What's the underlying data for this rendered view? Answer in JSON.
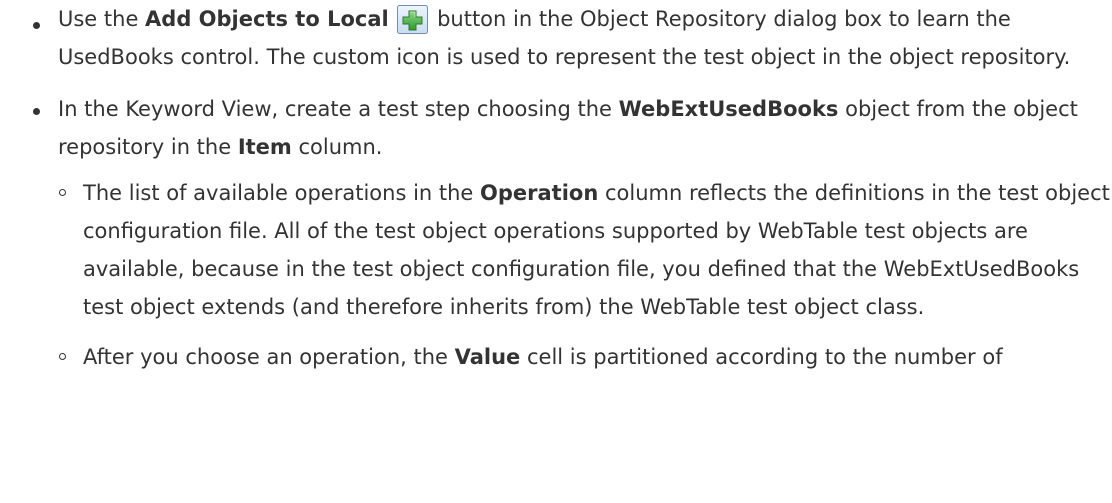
{
  "bullets": [
    {
      "before": "Use the ",
      "bold": "Add Objects to Local",
      "icon": "add-objects-plus-icon",
      "after": " button in the Object Repository dialog box to learn the UsedBooks control. The custom icon is used to represent the test object in the object repository."
    },
    {
      "part1": "In the Keyword View, create a test step choosing the ",
      "bold1": "WebExtUsedBooks",
      "part2": " object from the object repository in the ",
      "bold2": "Item",
      "part3": " column."
    }
  ],
  "sub_bullets": [
    {
      "part1": "The list of available operations in the ",
      "bold1": "Operation",
      "part2": " column reflects the definitions in the test object configuration file. All of the test object operations supported by WebTable test objects are available, because in the test object configuration file, you defined that the WebExtUsedBooks test object extends (and therefore inherits from) the WebTable test object class."
    },
    {
      "part1": "After you choose an operation, the ",
      "bold1": "Value",
      "part2": " cell is partitioned according to the number of"
    }
  ],
  "colors": {
    "text": "#333333",
    "icon_green": "#3aa53a",
    "icon_frame": "#6f8fb3"
  }
}
